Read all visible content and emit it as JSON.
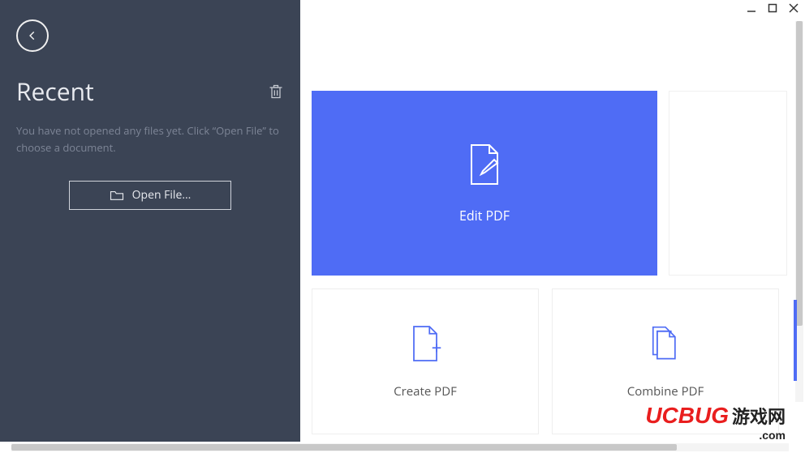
{
  "sidebar": {
    "title": "Recent",
    "empty_text": "You have not opened any files yet. Click “Open File” to choose a document.",
    "open_file_label": "Open File..."
  },
  "cards": {
    "edit": {
      "label": "Edit PDF"
    },
    "create": {
      "label": "Create PDF"
    },
    "combine": {
      "label": "Combine PDF"
    }
  },
  "watermark": {
    "brand": "UCBUG",
    "cn": "游戏网",
    "domain": ".com"
  },
  "colors": {
    "sidebar_bg": "#3b4455",
    "accent": "#4f6cf5"
  }
}
